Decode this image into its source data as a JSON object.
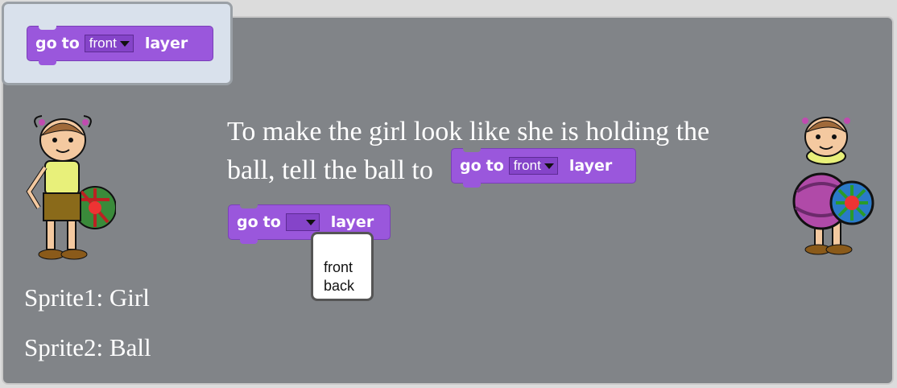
{
  "top_block": {
    "words": [
      "go",
      "to"
    ],
    "dropdown_value": "front",
    "suffix": "layer"
  },
  "instruction": {
    "line1": "To make the girl look like she is holding the",
    "line2_prefix": "ball, tell the ball to"
  },
  "inline_block": {
    "words": [
      "go",
      "to"
    ],
    "dropdown_value": "front",
    "suffix": "layer"
  },
  "editing_block": {
    "words": [
      "go",
      "to"
    ],
    "dropdown_value": "",
    "suffix": "layer"
  },
  "dropdown_menu": {
    "options": [
      "front",
      "back"
    ]
  },
  "sprites": {
    "sprite1_label": "Sprite1: Girl",
    "sprite2_label": "Sprite2: Ball"
  },
  "colors": {
    "block": "#9a57dc",
    "panel": "#818488",
    "tab": "#d9e1ec"
  },
  "icons": [
    "girl-sprite-icon",
    "ball-sprite-icon",
    "dropdown-caret-icon"
  ]
}
